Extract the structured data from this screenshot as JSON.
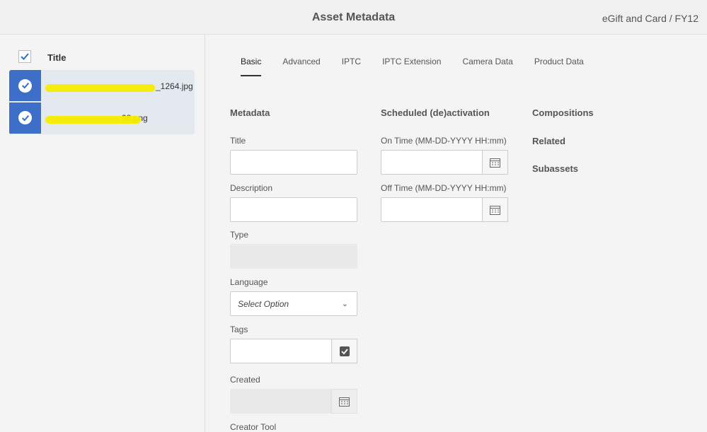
{
  "header": {
    "title": "Asset Metadata",
    "breadcrumb": "eGift and Card / FY12"
  },
  "list": {
    "column_title": "Title",
    "items": [
      {
        "name_visible": "_1264.jpg"
      },
      {
        "name_visible": "98.png"
      }
    ]
  },
  "tabs": [
    "Basic",
    "Advanced",
    "IPTC",
    "IPTC Extension",
    "Camera Data",
    "Product Data"
  ],
  "metadata": {
    "heading": "Metadata",
    "title_label": "Title",
    "description_label": "Description",
    "type_label": "Type",
    "language_label": "Language",
    "language_value": "Select Option",
    "tags_label": "Tags",
    "created_label": "Created",
    "creator_tool_label": "Creator Tool"
  },
  "schedule": {
    "heading": "Scheduled (de)activation",
    "on_label": "On Time (MM-DD-YYYY HH:mm)",
    "off_label": "Off Time (MM-DD-YYYY HH:mm)"
  },
  "side_links": [
    "Compositions",
    "Related",
    "Subassets"
  ],
  "colors": {
    "accent": "#3d6fc8",
    "checkbox": "#2c6ecb"
  }
}
